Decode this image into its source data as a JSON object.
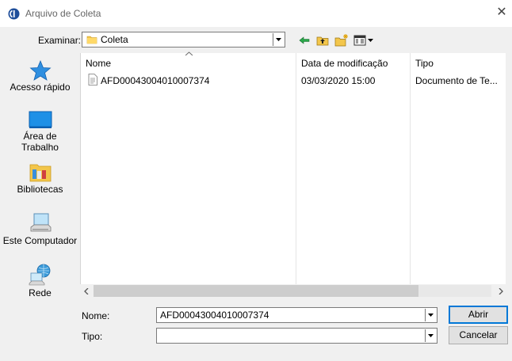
{
  "window": {
    "title": "Arquivo de Coleta",
    "close_icon": "close-icon"
  },
  "lookin": {
    "label": "Examinar:",
    "value": "Coleta"
  },
  "toolbar": {
    "icons": [
      "back-icon",
      "up-folder-icon",
      "new-folder-icon",
      "view-menu-icon"
    ]
  },
  "places": [
    {
      "label": "Acesso rápido",
      "icon": "star-icon"
    },
    {
      "label_line1": "Área de",
      "label_line2": "Trabalho",
      "icon": "desktop-icon"
    },
    {
      "label": "Bibliotecas",
      "icon": "libraries-icon"
    },
    {
      "label": "Este Computador",
      "icon": "computer-icon"
    },
    {
      "label": "Rede",
      "icon": "network-icon"
    }
  ],
  "filelist": {
    "columns": [
      "Nome",
      "Data de modificação",
      "Tipo"
    ],
    "rows": [
      {
        "name": "AFD00043004010007374",
        "modified": "03/03/2020 15:00",
        "type": "Documento de Te..."
      }
    ]
  },
  "filename": {
    "label": "Nome:",
    "value": "AFD00043004010007374"
  },
  "filetype": {
    "label": "Tipo:",
    "value": ""
  },
  "buttons": {
    "open": "Abrir",
    "cancel": "Cancelar"
  }
}
